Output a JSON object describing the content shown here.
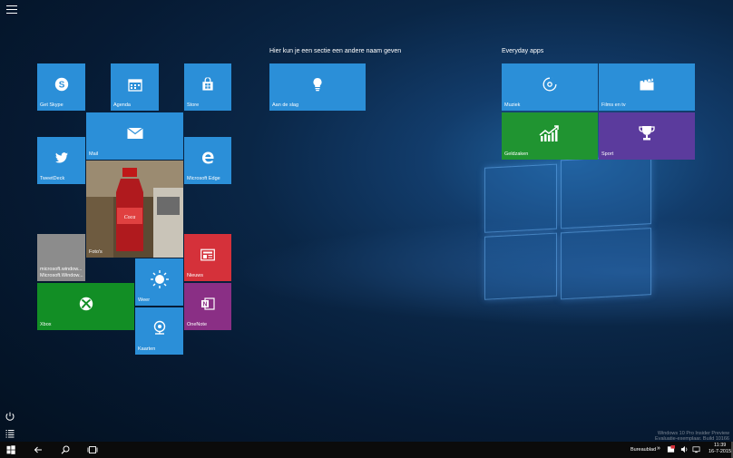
{
  "groups": {
    "group2_title": "Hier kun je een sectie een andere naam geven",
    "group3_title": "Everyday apps"
  },
  "tiles": {
    "skype": "Get Skype",
    "agenda": "Agenda",
    "store": "Store",
    "mail": "Mail",
    "twitter": "TweetDeck",
    "edge": "Microsoft Edge",
    "fotos": "Foto's",
    "msw": "microsoft.window...\nMicrosoft.Window...",
    "nieuws": "Nieuws",
    "weer": "Weer",
    "xbox": "Xbox",
    "onenote": "OneNote",
    "kaarten": "Kaarten",
    "aandeslag": "Aan de slag",
    "muziek": "Muziek",
    "films": "Films en tv",
    "geldzaken": "Geldzaken",
    "sport": "Sport"
  },
  "taskbar": {
    "bureaublad": "Bureaublad",
    "time": "11:39",
    "date": "16-7-2015"
  },
  "watermark": {
    "line1": "Windows 10 Pro Insider Preview",
    "line2": "Evaluatie-exemplaar. Build 10166"
  },
  "colors": {
    "tile_blue": "#2b8fd8",
    "tile_green": "#128e25",
    "tile_red": "#d5313a",
    "tile_purple": "#5b3b9d",
    "tile_onenote": "#8a2f85",
    "taskbar": "#0b0b0b"
  },
  "icons": [
    "hamburger-icon",
    "skype-icon",
    "calendar-icon",
    "store-icon",
    "mail-icon",
    "twitter-icon",
    "edge-icon",
    "news-icon",
    "weather-icon",
    "xbox-icon",
    "onenote-icon",
    "maps-icon",
    "lightbulb-icon",
    "music-icon",
    "film-icon",
    "chart-icon",
    "trophy-icon",
    "power-icon",
    "all-apps-icon",
    "windows-icon",
    "back-icon",
    "search-icon",
    "task-view-icon",
    "volume-icon",
    "network-icon",
    "action-center-icon"
  ]
}
